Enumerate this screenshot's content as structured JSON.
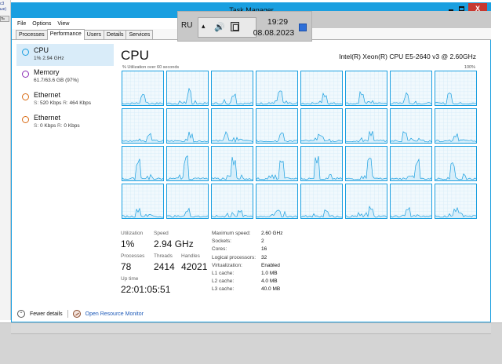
{
  "background": {
    "fragments": [
      "c3",
      "ые)"
    ],
    "button_fragment": "ть"
  },
  "window": {
    "title": "Task Manager",
    "controls": {
      "minimize": "",
      "maximize": "",
      "close": "X"
    }
  },
  "menu": [
    "File",
    "Options",
    "View"
  ],
  "tabs": [
    {
      "label": "Processes",
      "active": false
    },
    {
      "label": "Performance",
      "active": true
    },
    {
      "label": "Users",
      "active": false
    },
    {
      "label": "Details",
      "active": false
    },
    {
      "label": "Services",
      "active": false
    }
  ],
  "resources": [
    {
      "name": "CPU",
      "sub": "1% 2.94 GHz",
      "color": "#1a9fe0",
      "selected": true
    },
    {
      "name": "Memory",
      "sub": "61.7/63.6 GB (97%)",
      "color": "#8b2bb5",
      "selected": false
    },
    {
      "name": "Ethernet",
      "sub_s": "S: ",
      "sub_s_val": "520 Kbps",
      "sub_r": " R: ",
      "sub_r_val": "464 Kbps",
      "color": "#d96b14",
      "selected": false
    },
    {
      "name": "Ethernet",
      "sub_s": "S: ",
      "sub_s_val": "0 Kbps",
      "sub_r": " R: ",
      "sub_r_val": "0 Kbps",
      "color": "#d96b14",
      "selected": false
    }
  ],
  "cpu": {
    "title": "CPU",
    "model": "Intel(R) Xeon(R) CPU E5-2640 v3 @ 2.60GHz",
    "util_label": "% Utilization over 60 seconds",
    "util_max": "100%",
    "line_color": "#1a9fe0",
    "fill_color": "#f1f9fd"
  },
  "stats": {
    "utilization_label": "Utilization",
    "utilization": "1%",
    "speed_label": "Speed",
    "speed": "2.94 GHz",
    "processes_label": "Processes",
    "processes": "78",
    "threads_label": "Threads",
    "threads": "2414",
    "handles_label": "Handles",
    "handles": "42021",
    "uptime_label": "Up time",
    "uptime": "22:01:05:51"
  },
  "specs": [
    {
      "label": "Maximum speed:",
      "value": "2.60 GHz"
    },
    {
      "label": "Sockets:",
      "value": "2"
    },
    {
      "label": "Cores:",
      "value": "16"
    },
    {
      "label": "Logical processors:",
      "value": "32"
    },
    {
      "label": "Virtualization:",
      "value": "Enabled"
    },
    {
      "label": "L1 cache:",
      "value": "1.0 MB"
    },
    {
      "label": "L2 cache:",
      "value": "4.0 MB"
    },
    {
      "label": "L3 cache:",
      "value": "40.0 MB"
    }
  ],
  "footer": {
    "fewer_details": "Fewer details",
    "open_resource_monitor": "Open Resource Monitor"
  },
  "taskbar": {
    "language": "RU",
    "chevron": "▴",
    "speaker": "🔊",
    "time": "19:29",
    "date": "08.08.2023"
  }
}
